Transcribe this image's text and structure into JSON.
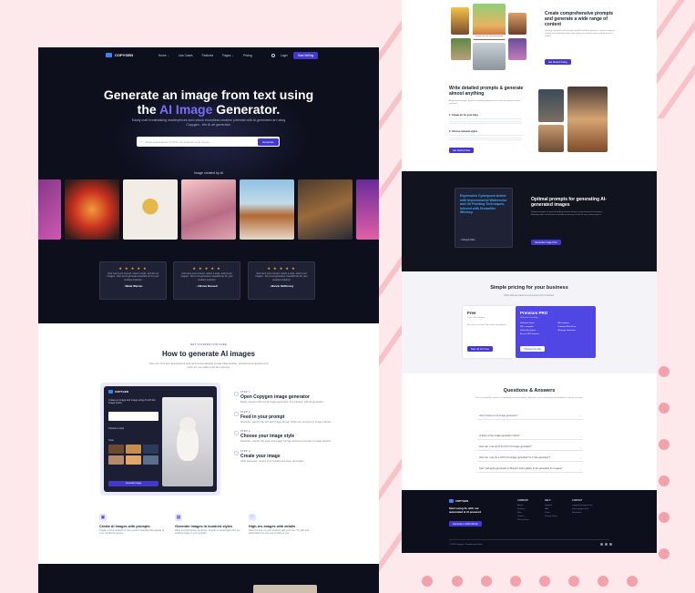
{
  "brand": {
    "name": "COPYGEN"
  },
  "nav": {
    "items": [
      "Home ⌄",
      "Use Cases",
      "Features",
      "Pages ⌄",
      "Pricing"
    ],
    "login": "Login",
    "cta": "Start Writing"
  },
  "hero": {
    "title_1": "Generate an image from text using",
    "title_the": "the",
    "title_accent": "AI Image",
    "title_end": "Generator.",
    "subtitle": "Easily craft breathtaking masterpieces and unlock boundless creative potential with AI-generated art using Copygen - the AI art generator.",
    "search_placeholder": "Enter a description of what you want the AI to create",
    "search_button": "Generate"
  },
  "gallery": {
    "title": "Image created by AI"
  },
  "testimonials": [
    {
      "stars": "★ ★ ★ ★ ★",
      "quote": "I just input your prompt, select a style, and let our images - then let AI generate beautiful art for your creative industry!",
      "name": "- Wade Warren"
    },
    {
      "stars": "★ ★ ★ ★ ★",
      "quote": "Just input your prompt, select a style, and let our images - the AI art generator, beautiful art for your creative industry!",
      "name": "- Oliviva Russell"
    },
    {
      "stars": "★ ★ ★ ★ ★",
      "quote": "Just input your prompt, select a style, and let our images - the AI art generator, beautiful art for your creative industry!",
      "name": "- Marvin McKinney"
    }
  ],
  "how": {
    "eyebrow": "GET STARTED FOR FREE",
    "title": "How to generate AI images",
    "subtitle": "Give our AI a few descriptions and we'll automatically create blog articles, product descriptions and more for you within just few second.",
    "steps": [
      {
        "label": "STEP 1",
        "title": "Open Copygen image generator",
        "desc": "Easily interact with our AI image generator. Pre-trained / with AI generator."
      },
      {
        "label": "STEP 2",
        "title": "Feed in your prompt",
        "desc": "Describe, specify the text and image format. Write text prompts or image upload."
      },
      {
        "label": "STEP 3",
        "title": "Choose your image style",
        "desc": "Describe, specify the style and image format. Add text prompts or image upload."
      },
      {
        "label": "STEP 4",
        "title": "Create your image",
        "desc": "Click Generate, review your results and save. Generate!"
      }
    ],
    "mock": {
      "brand": "COPYGEN",
      "heading": "Create an image and image using AI with the Image below.",
      "style_label": "Choose a style",
      "style_small": "Style",
      "button": "Generate Image"
    }
  },
  "features": [
    {
      "icon": "image-icon",
      "title": "Create AI Images with prompts",
      "desc": "Create a stock artwork of your product beautiful that appear at your interactive genres."
    },
    {
      "icon": "grid-icon",
      "title": "Generate images in hundred styles",
      "desc": "Write any descriptive sentence, program it and explore the pre-existing pages in your website."
    },
    {
      "icon": "heart-icon",
      "title": "High-res images with details",
      "desc": "Save the time on your product, add your own TV with and automation pro-res your results so you."
    }
  ],
  "right": {
    "s1": {
      "title": "Create comprehensive prompts and generate a wide range of content",
      "desc": "Creating comprehensive prompts enables the AI to generate a diverse range of content, from detailed product descriptions to creative stories and informative articles.",
      "button": "Get Started Today",
      "img_caption": "Colorful cake with colorful background"
    },
    "s2": {
      "title": "Write detailed prompts & generate almost anything",
      "desc": "AI-generated images based on detailed prompts can be used for various creative purposes.",
      "sub1": "1. Create art for your blog",
      "sub2": "2. Choose relevant styles",
      "button": "Get Started Now"
    },
    "s3": {
      "quote": "Expressive Cyberpunk Anime with Impressionist Watercolor and Oil Painting Techniques, Infused with Dreamlike Whimsy.",
      "author": "- Adeogh Allen",
      "title": "Optimal prompts for generating AI-generated images",
      "desc": "Optimal prompts for generating AI-generated images using advanced techniques, blending styles and textures to produce stunning results for any creative project.",
      "button": "Generate Image Now"
    },
    "pricing": {
      "title": "Simple pricing for your business",
      "subtitle": "Plans that are made for every kind of your business.",
      "free": {
        "name": "Free",
        "tagline": "Try for Free for Free",
        "desc": "No card is sent free. No credit card required.",
        "button": "Sign Up For Free"
      },
      "pro": {
        "name": "Premium PRO",
        "tagline": "Unlimited Possibility",
        "features": [
          "Unlimited words",
          "500 + template",
          "Unlimited projects",
          "Access SEO features",
          "All templates",
          "Unlimited Plan Price",
          "AI Image Generator"
        ],
        "button": "Choose this plan"
      }
    },
    "faq": {
      "title": "Questions & Answers",
      "subtitle": "We've covered the answers to commonly asked questions, and if you can't find what you are looking for, contact our team.",
      "items": [
        "How it works an AI image generator?",
        "Is there a free image generator online?",
        "How can I use an AI for Art to AI image generator?",
        "How can I pay for a GPT-3 AI image generator? Is it free generator?",
        "Can I self-apply generator or Should I enter gallery to the generator for images?"
      ]
    },
    "footer": {
      "tagline": "Start using AI, with our automated & AI powered",
      "cta": "Generate a 2000 Words",
      "col1": {
        "title": "COMPANY",
        "links": [
          "About",
          "Features",
          "Blog",
          "Contact",
          "Pricing Plans"
        ]
      },
      "col2": {
        "title": "HELP",
        "links": [
          "Support",
          "FAQ",
          "Terms",
          "Privacy Policy"
        ]
      },
      "col3": {
        "title": "CONTACT",
        "links": [
          "copygen@support.com",
          "www.copygen.tech",
          "Newsletter"
        ]
      },
      "copyright": "© 2023 Copygen. Template by Softnio"
    }
  },
  "colors": {
    "accent": "#4f46e5",
    "dark": "#0d0f1d",
    "page_bg": "#fde9ec",
    "star": "#f5b42a"
  }
}
